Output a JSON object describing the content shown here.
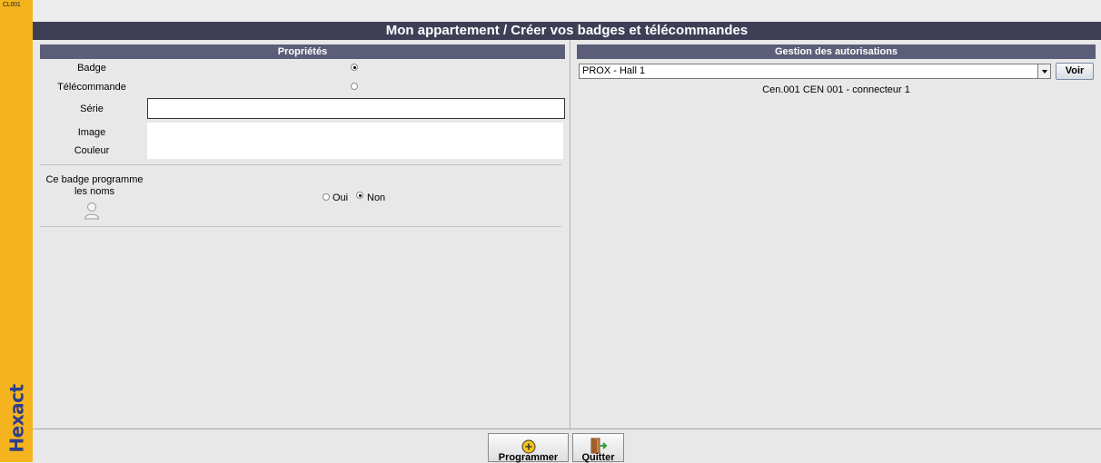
{
  "app": {
    "code": "CL001",
    "brand": "Hexact"
  },
  "title": "Mon appartement / Créer vos badges et télécommandes",
  "left_panel": {
    "header": "Propriétés",
    "type_badge_label": "Badge",
    "type_remote_label": "Télécommande",
    "selected_type": "Badge",
    "serie_label": "Série",
    "serie_value": "",
    "image_label": "Image",
    "couleur_label": "Couleur",
    "program_names_label": "Ce badge programme les noms",
    "oui_label": "Oui",
    "non_label": "Non",
    "program_names_selected": "Non"
  },
  "right_panel": {
    "header": "Gestion des autorisations",
    "selected_access": "PROX - Hall 1",
    "voir_label": "Voir",
    "connector": "Cen.001 CEN 001 - connecteur 1"
  },
  "footer": {
    "program_label": "Programmer",
    "quit_label": "Quitter"
  },
  "icons": {
    "plus": "plus-circle-icon",
    "quit": "door-exit-icon",
    "user": "user-icon",
    "dropdown": "chevron-down-icon"
  },
  "colors": {
    "brand_strip": "#f5b41e",
    "title_bar": "#3e3f56",
    "panel_header": "#5c5d78",
    "logo": "#2c3e8c"
  }
}
